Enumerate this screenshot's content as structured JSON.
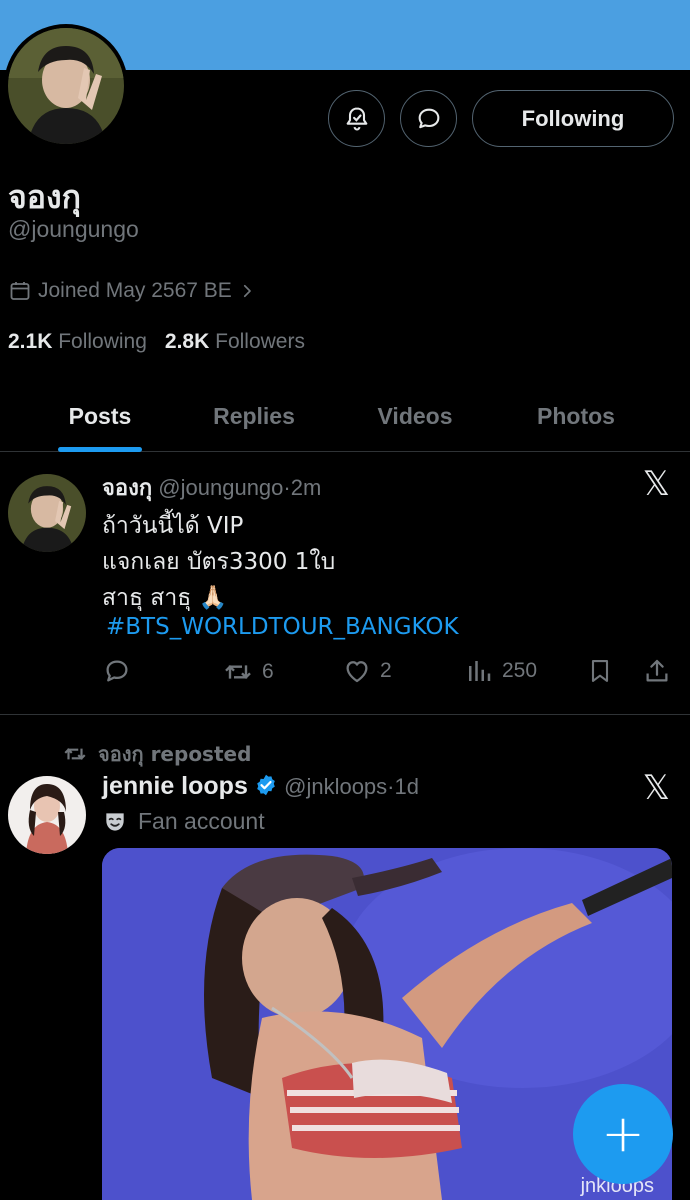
{
  "profile": {
    "name": "จองกุ",
    "handle": "@joungungo",
    "joined": "Joined May 2567 BE",
    "following_count": "2.1K",
    "following_label": "Following",
    "followers_count": "2.8K",
    "followers_label": "Followers"
  },
  "header": {
    "follow_button": "Following",
    "notify_icon": "bell-check-icon",
    "message_icon": "message-bubble-icon"
  },
  "tabs": [
    {
      "label": "Posts",
      "active": true
    },
    {
      "label": "Replies",
      "active": false
    },
    {
      "label": "Videos",
      "active": false
    },
    {
      "label": "Photos",
      "active": false
    }
  ],
  "post1": {
    "name": "จองกุ",
    "handle": "@joungungo",
    "time": "2m",
    "lines": [
      "ถ้าวันนี้ได้ VIP",
      "แจกเลย บัตร3300 1ใบ",
      "สาธุ สาธุ 🙏🏻"
    ],
    "hashtag": "#BTS_WORLDTOUR_BANGKOK",
    "reposts": "6",
    "likes": "2",
    "views": "250"
  },
  "post2": {
    "repost_label": "จองกุ reposted",
    "name": "jennie loops",
    "handle": "@jnkloops",
    "time": "1d",
    "label": "Fan account",
    "watermark": "jnkloops"
  },
  "colors": {
    "accent": "#1d9bf0",
    "banner": "#4b9fe1",
    "muted": "#71767b",
    "text": "#e7e9ea",
    "border": "#2f3336"
  }
}
